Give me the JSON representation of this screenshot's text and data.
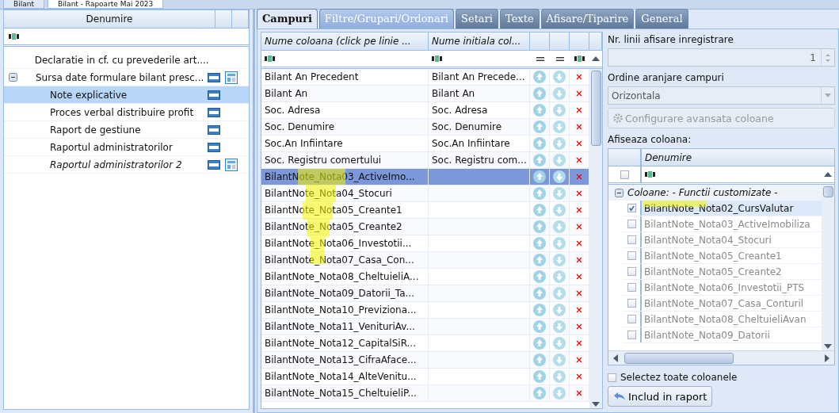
{
  "top_tabs": [
    {
      "label": "Bilant",
      "selected": false
    },
    {
      "label": "Bilant - Rapoarte Mai 2023",
      "selected": true
    }
  ],
  "tree": {
    "column": "Denumire",
    "items": [
      {
        "label": "Declaratie in cf. cu prevederile art....",
        "selected": false,
        "italic": false,
        "html_icon": false,
        "layout_icon": false
      },
      {
        "label": "Sursa date formulare bilant presc...",
        "selected": false,
        "italic": false,
        "html_icon": true,
        "layout_icon": true,
        "expanded": true,
        "children": [
          {
            "label": "Note explicative",
            "selected": true,
            "italic": false,
            "html_icon": true,
            "layout_icon": false
          },
          {
            "label": "Proces verbal distribuire profit",
            "selected": false,
            "italic": false,
            "html_icon": true,
            "layout_icon": false
          },
          {
            "label": "Raport de gestiune",
            "selected": false,
            "italic": false,
            "html_icon": true,
            "layout_icon": false
          },
          {
            "label": "Raportul administratorilor",
            "selected": false,
            "italic": false,
            "html_icon": true,
            "layout_icon": false
          },
          {
            "label": "Raportul administratorilor 2",
            "selected": false,
            "italic": true,
            "html_icon": true,
            "layout_icon": true
          }
        ]
      }
    ]
  },
  "tabs": [
    {
      "label": "Campuri",
      "selected": true,
      "hovered": false
    },
    {
      "label": "Filtre/Grupari/Ordonari",
      "selected": false,
      "hovered": true
    },
    {
      "label": "Setari",
      "selected": false,
      "hovered": false
    },
    {
      "label": "Texte",
      "selected": false,
      "hovered": false
    },
    {
      "label": "Afisare/Tiparire",
      "selected": false,
      "hovered": false
    },
    {
      "label": "General",
      "selected": false,
      "hovered": false
    }
  ],
  "grid": {
    "columns": [
      "Nume coloana (click pe linie ...",
      "Nume initiala col..."
    ],
    "rows": [
      {
        "name": "Bilant An Precedent",
        "initial": "Bilant An Precede...",
        "selected": false
      },
      {
        "name": "Bilant An",
        "initial": "Bilant An",
        "selected": false
      },
      {
        "name": "Soc. Adresa",
        "initial": "Soc. Adresa",
        "selected": false
      },
      {
        "name": "Soc. Denumire",
        "initial": "Soc. Denumire",
        "selected": false
      },
      {
        "name": "Soc.An Infiintare",
        "initial": "Soc.An Infiintare",
        "selected": false
      },
      {
        "name": "Soc. Registru comertului",
        "initial": "Soc. Registru com...",
        "selected": false
      },
      {
        "name": "BilantNote_Nota03_ActiveImo...",
        "initial": "",
        "selected": true
      },
      {
        "name": "BilantNote_Nota04_Stocuri",
        "initial": "",
        "selected": false
      },
      {
        "name": "BilantNote_Nota05_Creante1",
        "initial": "",
        "selected": false
      },
      {
        "name": "BilantNote_Nota05_Creante2",
        "initial": "",
        "selected": false
      },
      {
        "name": "BilantNote_Nota06_Investotii...",
        "initial": "",
        "selected": false
      },
      {
        "name": "BilantNote_Nota07_Casa_Con...",
        "initial": "",
        "selected": false
      },
      {
        "name": "BilantNote_Nota08_CheltuieliA...",
        "initial": "",
        "selected": false
      },
      {
        "name": "BilantNote_Nota09_Datorii_Ta...",
        "initial": "",
        "selected": false
      },
      {
        "name": "BilantNote_Nota10_Previziona...",
        "initial": "",
        "selected": false
      },
      {
        "name": "BilantNote_Nota11_VenituriAv...",
        "initial": "",
        "selected": false
      },
      {
        "name": "BilantNote_Nota12_CapitalSiR...",
        "initial": "",
        "selected": false
      },
      {
        "name": "BilantNote_Nota13_CifraAface...",
        "initial": "",
        "selected": false
      },
      {
        "name": "BilantNote_Nota14_AlteVenitu...",
        "initial": "",
        "selected": false
      },
      {
        "name": "BilantNote_Nota15_CheltuieliP...",
        "initial": "",
        "selected": false
      }
    ]
  },
  "settings": {
    "lines_label": "Nr. linii afisare inregistrare",
    "lines_value": "1",
    "order_label": "Ordine aranjare campuri",
    "order_value": "Orizontala",
    "config_button": "Configurare avansata coloane",
    "show_label": "Afiseaza coloana:",
    "list": {
      "column": "Denumire",
      "group": "Coloane:  - Functii customizate -",
      "group_expanded": true,
      "items": [
        {
          "label": "BilantNote_Nota02_CursValutar",
          "checked": true,
          "selected": true
        },
        {
          "label": "BilantNote_Nota03_ActiveImobiliza",
          "checked": false,
          "selected": false
        },
        {
          "label": "BilantNote_Nota04_Stocuri",
          "checked": false,
          "selected": false
        },
        {
          "label": "BilantNote_Nota05_Creante1",
          "checked": false,
          "selected": false
        },
        {
          "label": "BilantNote_Nota05_Creante2",
          "checked": false,
          "selected": false
        },
        {
          "label": "BilantNote_Nota06_Investotii_PTS",
          "checked": false,
          "selected": false
        },
        {
          "label": "BilantNote_Nota07_Casa_Conturil",
          "checked": false,
          "selected": false
        },
        {
          "label": "BilantNote_Nota08_CheltuieliAvan",
          "checked": false,
          "selected": false
        },
        {
          "label": "BilantNote_Nota09_Datorii",
          "checked": false,
          "selected": false
        }
      ]
    },
    "header_checked": false,
    "select_all": {
      "label": "Selectez toate coloanele",
      "checked": false
    },
    "include_button": "Includ in raport"
  }
}
